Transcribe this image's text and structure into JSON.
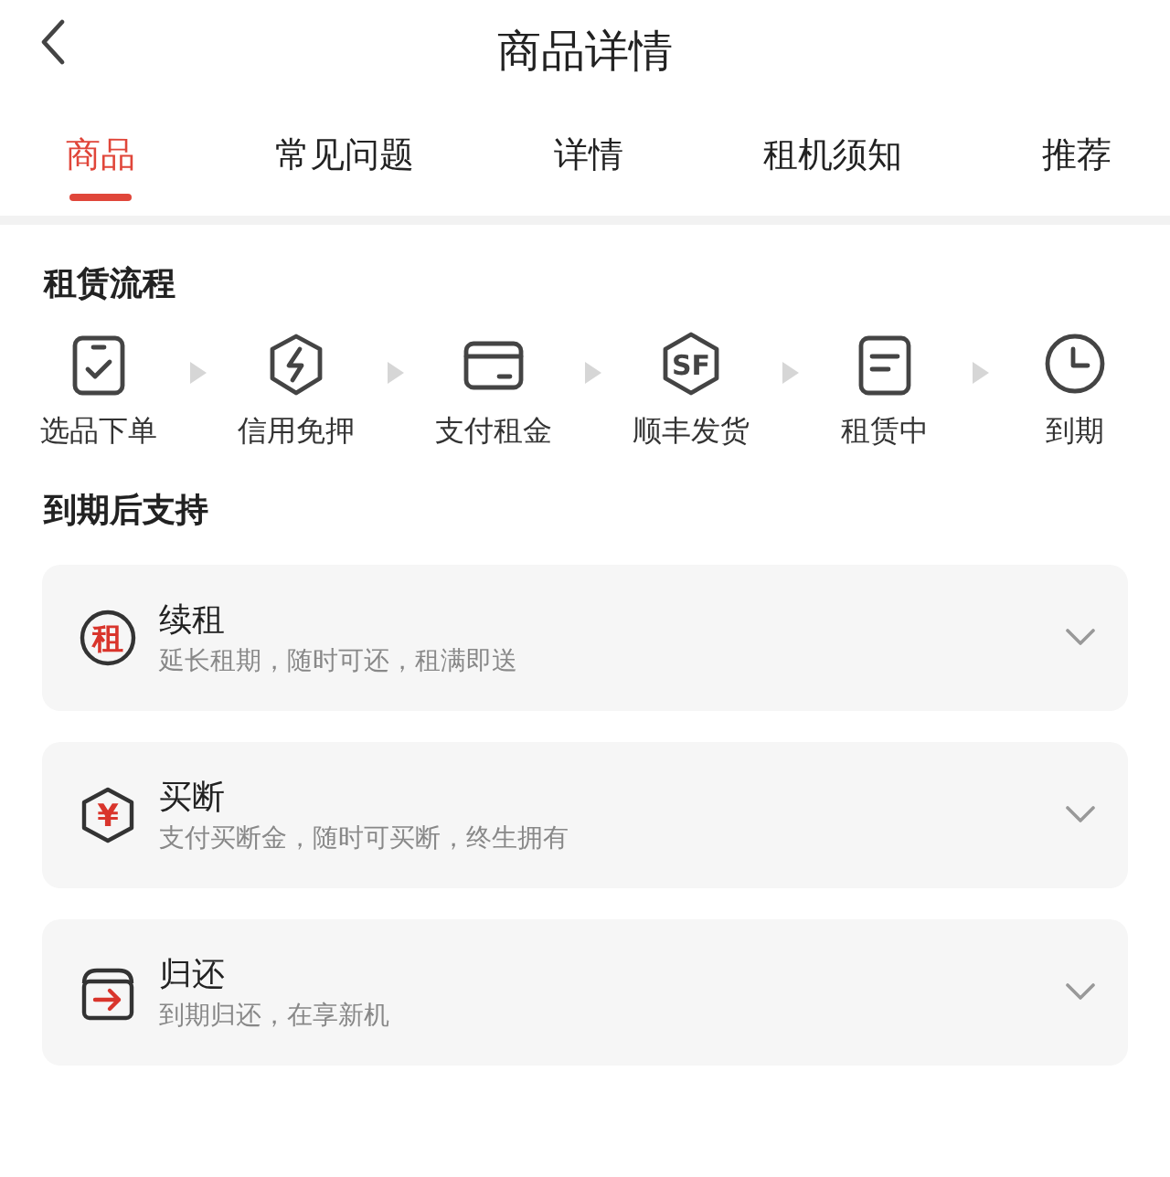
{
  "header": {
    "title": "商品详情"
  },
  "tabs": [
    {
      "label": "商品",
      "selected": true
    },
    {
      "label": "常见问题",
      "selected": false
    },
    {
      "label": "详情",
      "selected": false
    },
    {
      "label": "租机须知",
      "selected": false
    },
    {
      "label": "推荐",
      "selected": false
    }
  ],
  "process": {
    "title": "租赁流程",
    "steps": [
      {
        "kind": "clipboard",
        "label": "选品下单"
      },
      {
        "kind": "shield",
        "label": "信用免押"
      },
      {
        "kind": "card",
        "label": "支付租金"
      },
      {
        "kind": "badge",
        "glyph": "SF",
        "label": "顺丰发货"
      },
      {
        "kind": "document",
        "label": "租赁中"
      },
      {
        "kind": "clock",
        "label": "到期"
      }
    ]
  },
  "support": {
    "title": "到期后支持",
    "options": [
      {
        "kind": "circle",
        "glyph": "租",
        "title": "续租",
        "subtitle": "延长租期，随时可还，租满即送",
        "expanded": false
      },
      {
        "kind": "hexagon",
        "glyph": "¥",
        "title": "买断",
        "subtitle": "支付买断金，随时可买断，终生拥有",
        "expanded": false
      },
      {
        "kind": "box",
        "title": "归还",
        "subtitle": "到期归还，在享新机",
        "expanded": false
      }
    ]
  }
}
